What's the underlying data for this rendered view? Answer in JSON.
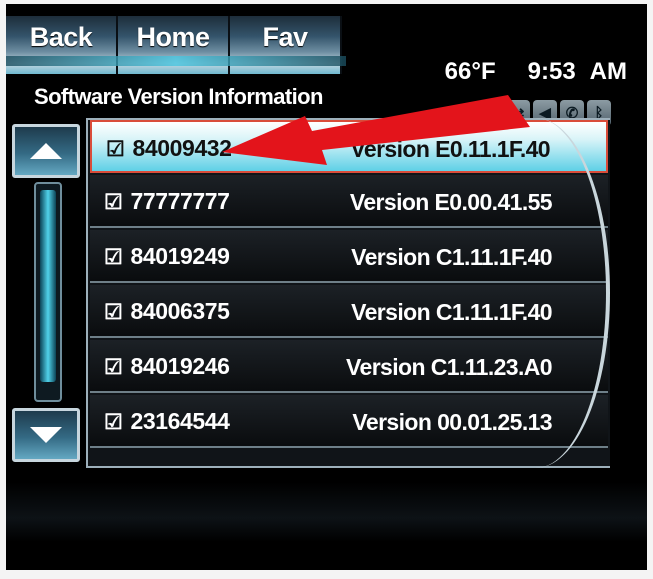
{
  "nav": {
    "back_label": "Back",
    "home_label": "Home",
    "fav_label": "Fav"
  },
  "status": {
    "temperature": "66°F",
    "time": "9:53",
    "ampm": "AM"
  },
  "status_icons": [
    "voice-icon",
    "shuffle-icon",
    "mute-icon",
    "phone-icon",
    "bluetooth-icon"
  ],
  "page_title": "Software Version Information",
  "checkbox_glyph": "☑",
  "list": {
    "items": [
      {
        "part": "84009432",
        "version": "Version E0.11.1F.40",
        "selected": true
      },
      {
        "part": "77777777",
        "version": "Version E0.00.41.55",
        "selected": false
      },
      {
        "part": "84019249",
        "version": "Version C1.11.1F.40",
        "selected": false
      },
      {
        "part": "84006375",
        "version": "Version C1.11.1F.40",
        "selected": false
      },
      {
        "part": "84019246",
        "version": "Version C1.11.23.A0",
        "selected": false
      },
      {
        "part": "23164544",
        "version": "Version 00.01.25.13",
        "selected": false
      }
    ]
  },
  "colors": {
    "accent": "#49c6e0",
    "annotation_arrow": "#e3141b"
  }
}
